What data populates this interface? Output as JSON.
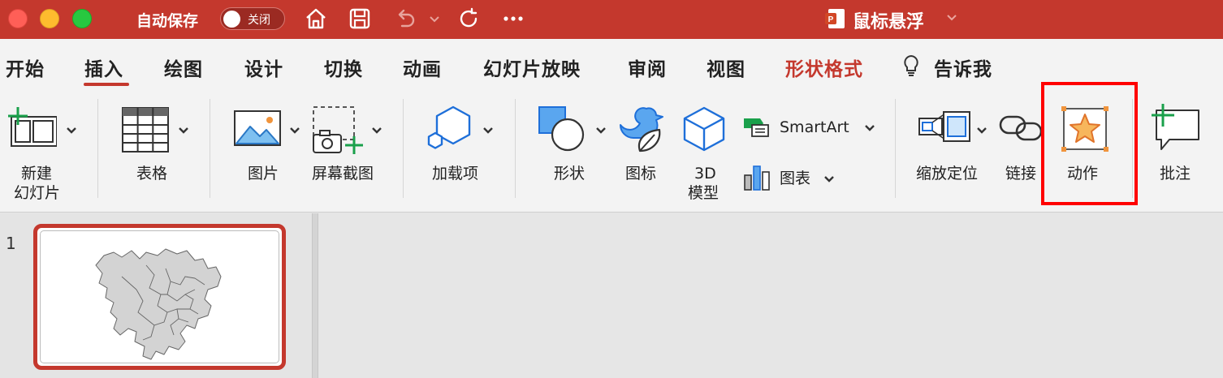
{
  "titlebar": {
    "autosave_label": "自动保存",
    "autosave_state": "关闭",
    "doc_title": "鼠标悬浮",
    "icons": [
      "home-icon",
      "save-icon",
      "undo-icon",
      "redo-icon",
      "more-icon",
      "powerpoint-icon"
    ]
  },
  "tabs": [
    {
      "label": "开始"
    },
    {
      "label": "插入",
      "active": true
    },
    {
      "label": "绘图"
    },
    {
      "label": "设计"
    },
    {
      "label": "切换"
    },
    {
      "label": "动画"
    },
    {
      "label": "幻灯片放映"
    },
    {
      "label": "审阅"
    },
    {
      "label": "视图"
    },
    {
      "label": "形状格式",
      "contextual": true
    },
    {
      "label": "告诉我",
      "icon": "lightbulb-icon"
    }
  ],
  "ribbon": {
    "new_slide": {
      "line1": "新建",
      "line2": "幻灯片"
    },
    "table": "表格",
    "picture": "图片",
    "screenshot": "屏幕截图",
    "addins": "加载项",
    "shapes": "形状",
    "icons": "图标",
    "model3d": {
      "line1": "3D",
      "line2": "模型"
    },
    "smartart": "SmartArt",
    "chart": "图表",
    "zoom": "缩放定位",
    "link": "链接",
    "action": "动作",
    "comment": "批注"
  },
  "slides": {
    "panel_number": "1"
  },
  "colors": {
    "accent": "#c4382d",
    "highlight": "#ff0000",
    "ribbon_bg": "#f3f3f3",
    "icon_blue": "#1e6fd9",
    "icon_green": "#1aa04b",
    "icon_orange": "#f0943c"
  }
}
